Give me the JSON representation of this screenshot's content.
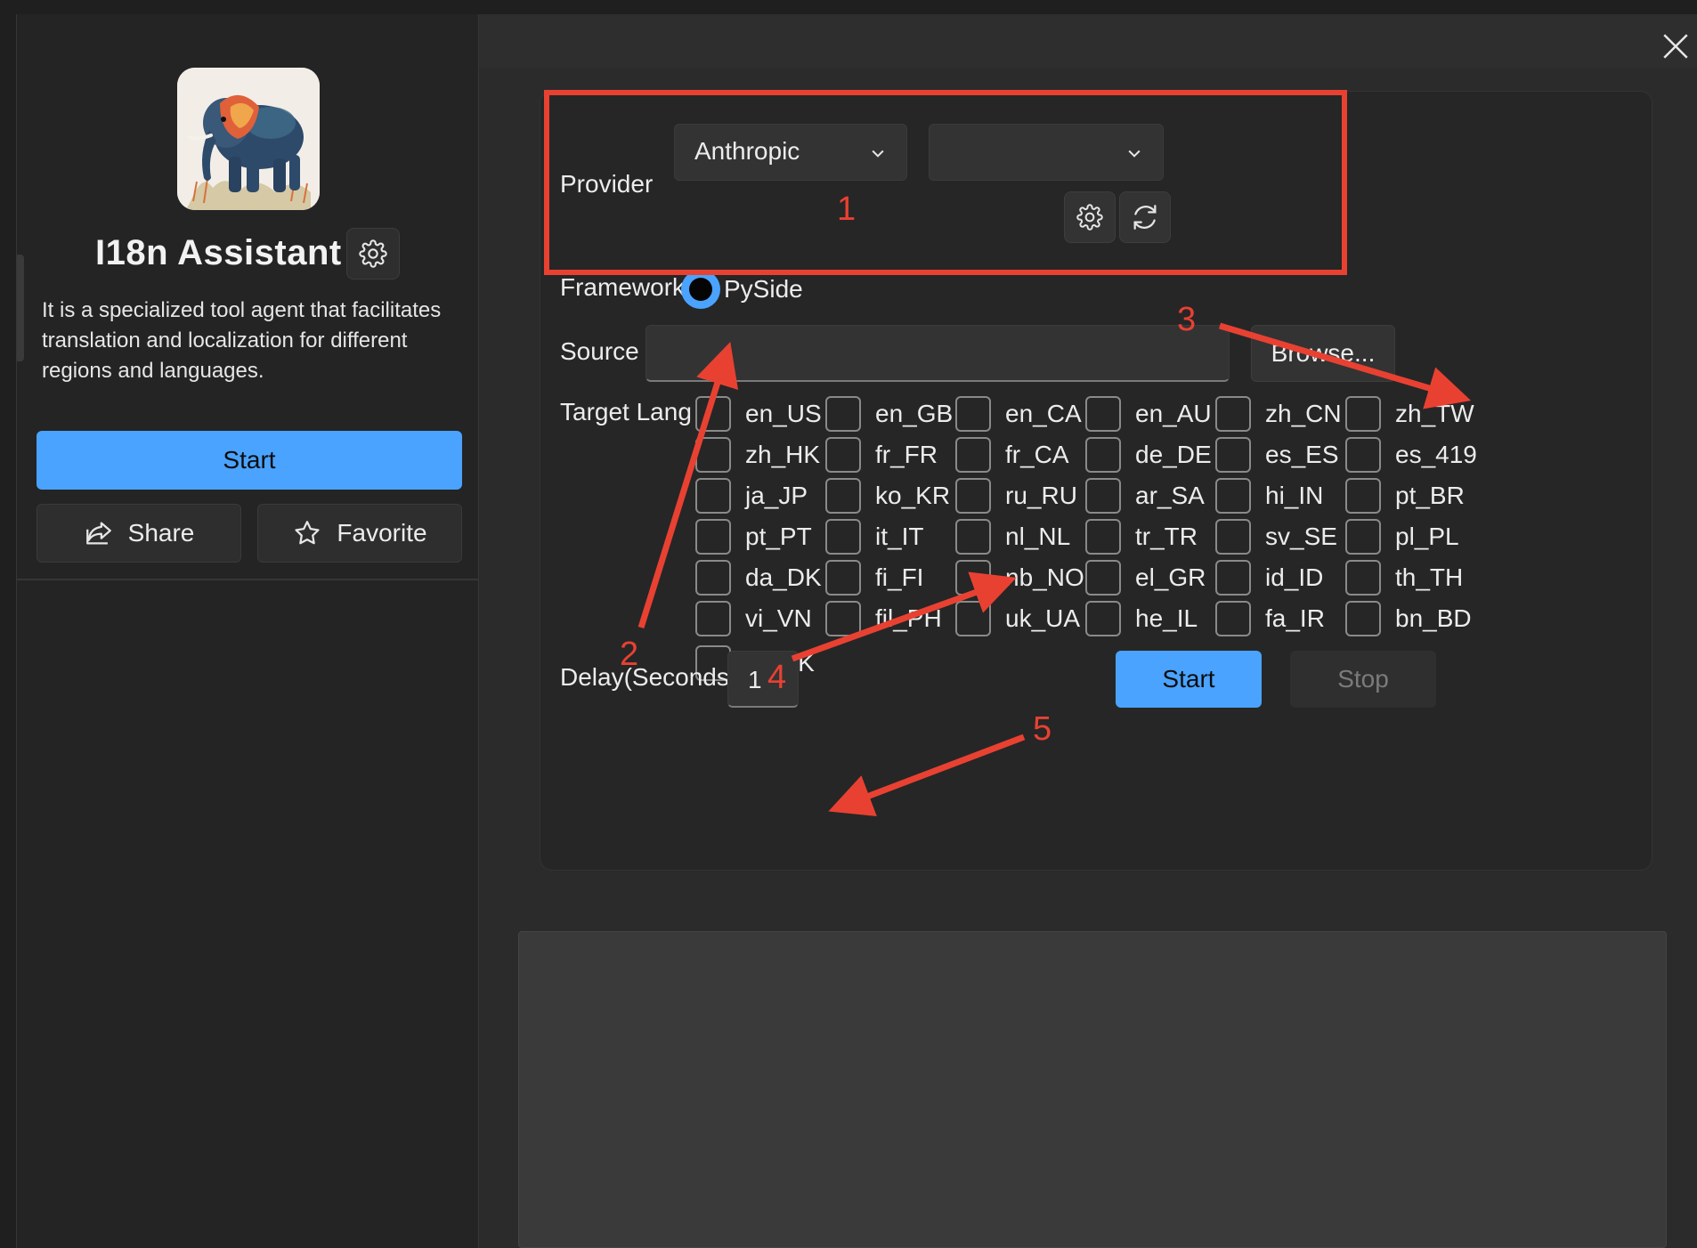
{
  "sidebar": {
    "app_title": "I18n Assistant",
    "description": "It is a specialized tool agent that facilitates translation and localization for different regions and languages.",
    "start_label": "Start",
    "share_label": "Share",
    "favorite_label": "Favorite",
    "icons": {
      "settings": "gear-icon",
      "share": "share-icon",
      "favorite": "star-icon",
      "logo": "elephant-logo"
    }
  },
  "main": {
    "close_icon": "close-icon",
    "provider": {
      "label": "Provider",
      "selected": "Anthropic",
      "model_selected": ""
    },
    "framework": {
      "label": "Framework",
      "option": "PySide"
    },
    "source": {
      "label": "Source",
      "value": "",
      "browse_label": "Browse..."
    },
    "target": {
      "label": "Target Lang",
      "languages": [
        "en_US",
        "en_GB",
        "en_CA",
        "en_AU",
        "zh_CN",
        "zh_TW",
        "zh_HK",
        "fr_FR",
        "fr_CA",
        "de_DE",
        "es_ES",
        "es_419",
        "ja_JP",
        "ko_KR",
        "ru_RU",
        "ar_SA",
        "hi_IN",
        "pt_BR",
        "pt_PT",
        "it_IT",
        "nl_NL",
        "tr_TR",
        "sv_SE",
        "pl_PL",
        "da_DK",
        "fi_FI",
        "nb_NO",
        "el_GR",
        "id_ID",
        "th_TH",
        "vi_VN",
        "fil_PH",
        "uk_UA",
        "he_IL",
        "fa_IR",
        "bn_BD",
        "ur_PK"
      ]
    },
    "delay": {
      "label": "Delay(Seconds)",
      "value": "1"
    },
    "start_label": "Start",
    "stop_label": "Stop"
  },
  "annotations": [
    "1",
    "2",
    "3",
    "4",
    "5"
  ],
  "colors": {
    "accent": "#4aa3ff",
    "annotation": "#e84132",
    "background": "#1f1f1f",
    "panel": "#262626"
  }
}
